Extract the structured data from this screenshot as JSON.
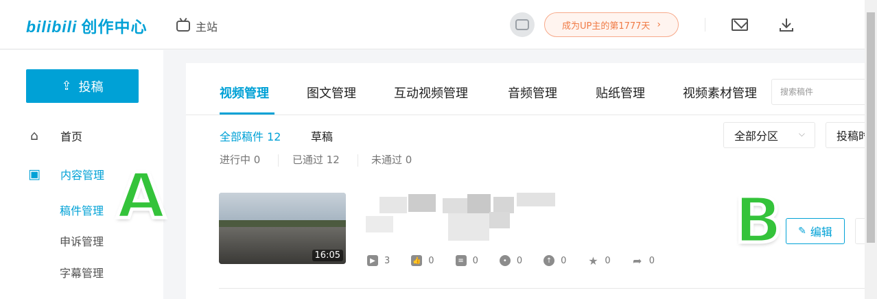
{
  "header": {
    "logo_bili": "bilibili",
    "logo_text": "创作中心",
    "main_site": "主站",
    "up_badge": "成为UP主的第1777天",
    "up_badge_chevron": "›"
  },
  "sidebar": {
    "upload_label": "投稿",
    "items": [
      {
        "label": "首页",
        "icon": "home-icon"
      },
      {
        "label": "内容管理",
        "icon": "content-icon"
      }
    ],
    "subitems": [
      "稿件管理",
      "申诉管理",
      "字幕管理"
    ]
  },
  "tabs": [
    "视频管理",
    "图文管理",
    "互动视频管理",
    "音频管理",
    "贴纸管理",
    "视频素材管理"
  ],
  "search": {
    "placeholder": "搜索稿件"
  },
  "filters": {
    "all_label": "全部稿件 12",
    "draft_label": "草稿",
    "status": [
      "进行中 0",
      "已通过 12",
      "未通过 0"
    ],
    "category_select": "全部分区",
    "sort_select": "投稿时"
  },
  "video": {
    "duration": "16:05",
    "stats": [
      {
        "icon": "play-icon",
        "value": "3"
      },
      {
        "icon": "like-icon",
        "value": "0"
      },
      {
        "icon": "danmaku-icon",
        "value": "0"
      },
      {
        "icon": "comment-icon",
        "value": "0"
      },
      {
        "icon": "coin-icon",
        "value": "0"
      },
      {
        "icon": "star-icon",
        "value": "0"
      },
      {
        "icon": "share-icon",
        "value": "0"
      }
    ],
    "edit_label": "编辑"
  },
  "markers": {
    "a": "A",
    "b": "B"
  },
  "colors": {
    "accent": "#00a1d6",
    "badge": "#f07b46",
    "marker": "#34c33a"
  }
}
